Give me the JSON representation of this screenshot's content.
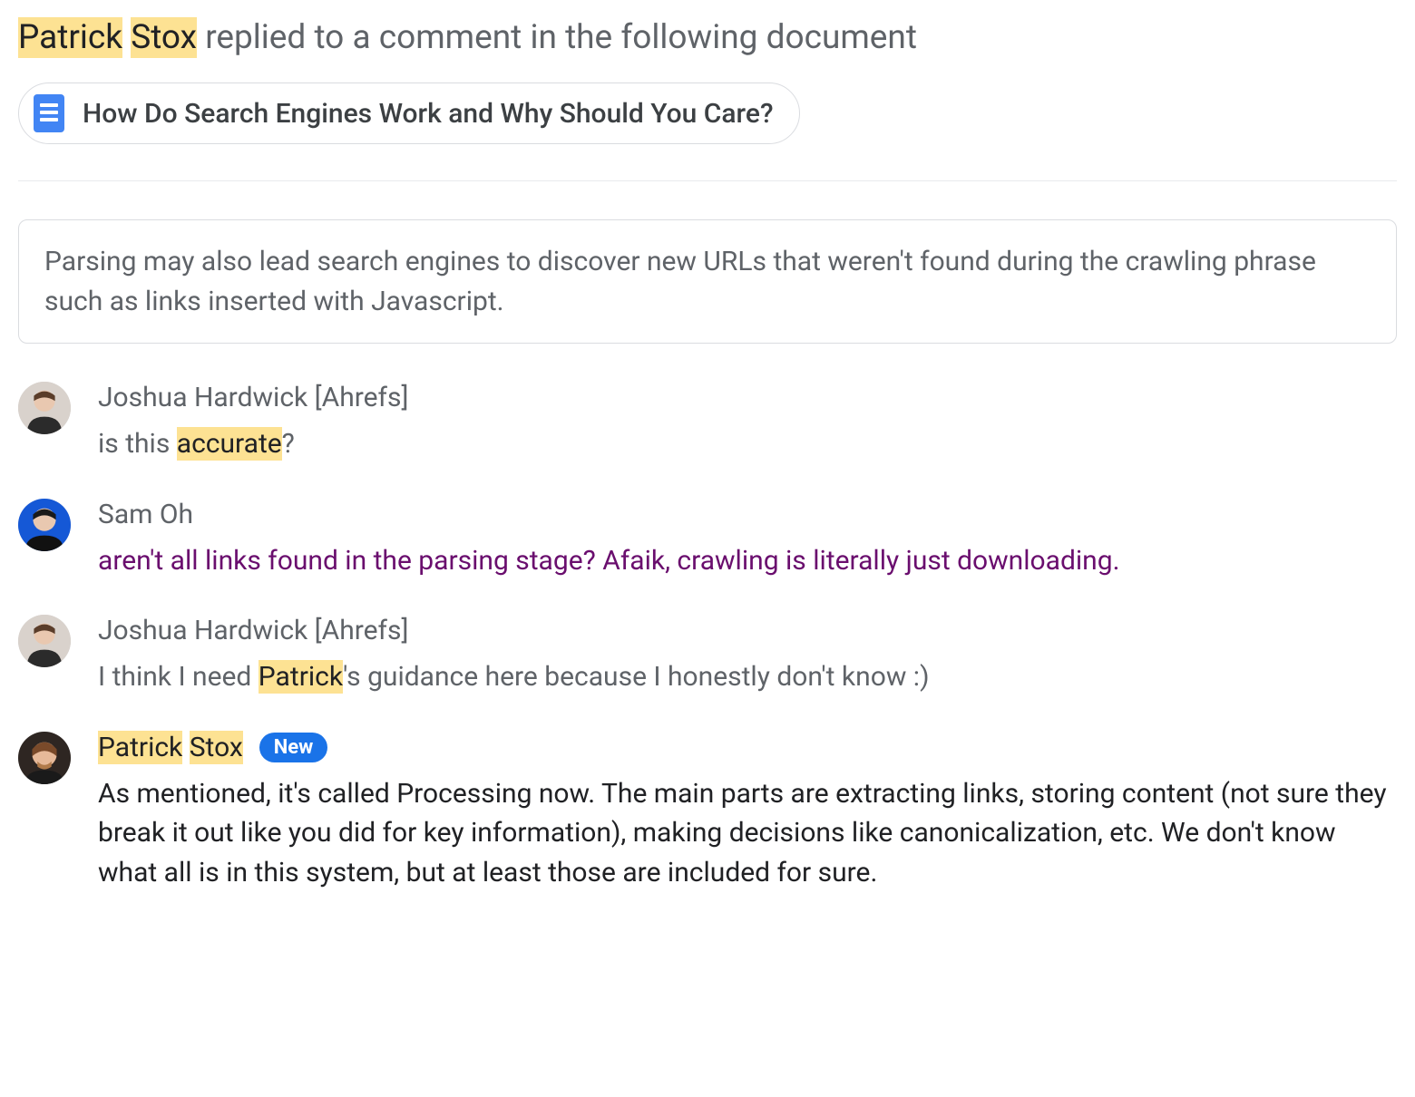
{
  "header": {
    "actor_first": "Patrick",
    "actor_last": "Stox",
    "action_text": " replied to a comment in the following document"
  },
  "document": {
    "title": "How Do Search Engines Work and Why Should You Care?"
  },
  "context_text": "Parsing may also lead search engines to discover new URLs that weren't found during the crawling phrase such as links inserted with Javascript.",
  "comments": {
    "c0": {
      "author": "Joshua Hardwick [Ahrefs]",
      "text_pre": "is this ",
      "text_hl": "accurate",
      "text_post": "?"
    },
    "c1": {
      "author": "Sam Oh",
      "text": "aren't all links found in the parsing stage? Afaik, crawling is literally just downloading."
    },
    "c2": {
      "author": "Joshua Hardwick [Ahrefs]",
      "text_pre": "I think I need ",
      "text_hl": "Patrick",
      "text_post": "'s guidance here because I honestly don't know :)"
    },
    "c3": {
      "author_first": "Patrick",
      "author_last": "Stox",
      "badge": "New",
      "text": "As mentioned, it's called Processing now. The main parts are extracting links, storing content (not sure they break it out like you did for key information), making decisions like canonicalization, etc. We don't know what all is in this system, but at least those are included for sure."
    }
  }
}
